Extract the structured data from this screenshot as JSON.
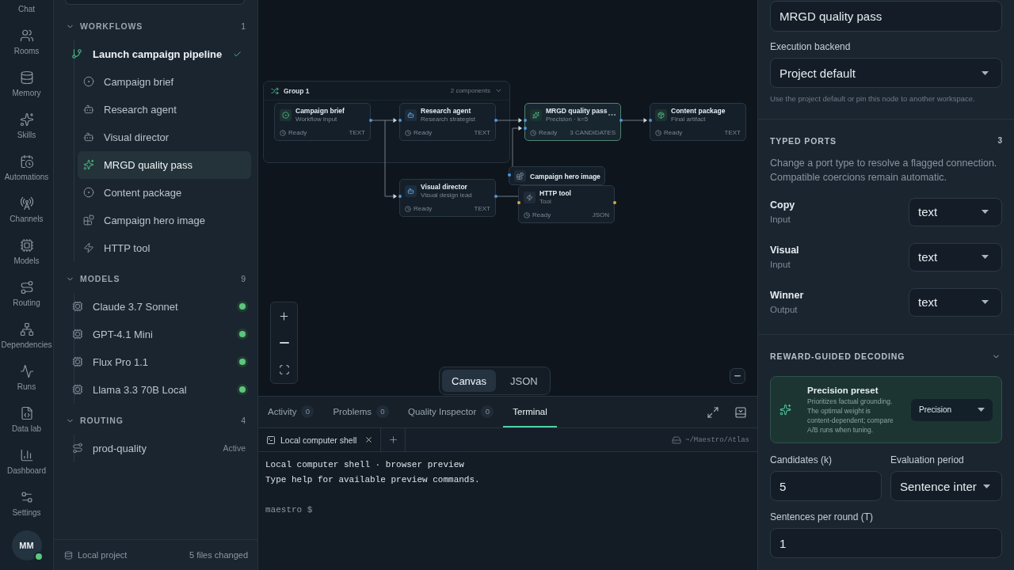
{
  "rail": {
    "partial_label": "Chat",
    "items": [
      {
        "label": "Rooms"
      },
      {
        "label": "Memory"
      },
      {
        "label": "Skills"
      },
      {
        "label": "Automations"
      },
      {
        "label": "Channels"
      },
      {
        "label": "Models"
      },
      {
        "label": "Routing"
      },
      {
        "label": "Dependencies"
      },
      {
        "label": "Runs"
      },
      {
        "label": "Data lab"
      },
      {
        "label": "Dashboard"
      },
      {
        "label": "Settings"
      }
    ],
    "avatar": {
      "initials": "MM",
      "online": true
    }
  },
  "sidebar": {
    "sections": [
      {
        "kind": "tree",
        "title": "WORKFLOWS",
        "count": "1",
        "expanded": true,
        "items": [
          {
            "label": "Launch campaign pipeline",
            "verified": true,
            "selected": false,
            "children": [
              {
                "label": "Campaign brief",
                "kind": "input",
                "selected": false
              },
              {
                "label": "Research agent",
                "kind": "agent",
                "selected": false
              },
              {
                "label": "Visual director",
                "kind": "agent",
                "selected": false
              },
              {
                "label": "MRGD quality pass",
                "kind": "evaluator",
                "selected": true
              },
              {
                "label": "Content package",
                "kind": "output",
                "selected": false
              },
              {
                "label": "Campaign hero image",
                "kind": "image",
                "selected": false
              },
              {
                "label": "HTTP tool",
                "kind": "tool",
                "selected": false
              }
            ]
          }
        ]
      },
      {
        "kind": "models",
        "title": "MODELS",
        "count": "9",
        "expanded": true,
        "items": [
          {
            "label": "Claude 3.7 Sonnet",
            "online": true
          },
          {
            "label": "GPT-4.1 Mini",
            "online": true
          },
          {
            "label": "Flux Pro 1.1",
            "online": true
          },
          {
            "label": "Llama 3.3 70B Local",
            "online": true
          }
        ]
      },
      {
        "kind": "routes",
        "title": "ROUTING",
        "count": "4",
        "expanded": true,
        "items": [
          {
            "label": "prod-quality",
            "status": "Active"
          }
        ]
      }
    ],
    "footer": {
      "project": "Local project",
      "changes": "5 files changed"
    }
  },
  "canvas": {
    "group": {
      "title": "Group 1",
      "count": "2 components",
      "expanded": true
    },
    "nodes": [
      {
        "title": "Campaign brief",
        "subtitle": "Workflow input",
        "status": "Ready",
        "port_type": "TEXT",
        "kind": "input",
        "selected": false
      },
      {
        "title": "Research agent",
        "subtitle": "Research strategist",
        "status": "Ready",
        "port_type": "TEXT",
        "kind": "agent",
        "selected": false
      },
      {
        "title": "MRGD quality pass",
        "subtitle": "Precision · k=5",
        "status": "Ready",
        "port_type": "3 CANDIDATES",
        "kind": "evaluator",
        "selected": true
      },
      {
        "title": "Content package",
        "subtitle": "Final artifact",
        "status": "Ready",
        "port_type": "TEXT",
        "kind": "output",
        "selected": false
      },
      {
        "title": "Visual director",
        "subtitle": "Visual design lead",
        "status": "Ready",
        "port_type": "TEXT",
        "kind": "agent",
        "selected": false
      },
      {
        "title": "Campaign hero image",
        "kind": "image",
        "selected": false
      },
      {
        "title": "HTTP tool",
        "subtitle": "Tool",
        "status": "Ready",
        "port_type": "JSON",
        "kind": "tool",
        "selected": false
      }
    ],
    "view_toggle": [
      {
        "label": "Canvas",
        "selected": true
      },
      {
        "label": "JSON",
        "selected": false
      }
    ]
  },
  "bottom_panel": {
    "tabs": [
      {
        "label": "Activity",
        "count": "0",
        "selected": false
      },
      {
        "label": "Problems",
        "count": "0",
        "selected": false
      },
      {
        "label": "Quality Inspector",
        "count": "0",
        "selected": false
      },
      {
        "label": "Terminal",
        "selected": true
      }
    ],
    "terminal": {
      "sessions": [
        {
          "label": "Local computer shell",
          "selected": true
        }
      ],
      "cwd": "~/Maestro/Atlas",
      "lines": [
        "Local computer shell · browser preview",
        "Type help for available preview commands."
      ],
      "prompt": "maestro $"
    }
  },
  "inspector": {
    "name_field": {
      "value": "MRGD quality pass"
    },
    "execution_backend": {
      "label": "Execution backend",
      "value": "Project default",
      "help": "Use the project default or pin this node to another workspace."
    },
    "typed_ports": {
      "title": "TYPED PORTS",
      "count": "3",
      "description": "Change a port type to resolve a flagged connection. Compatible coercions remain automatic.",
      "ports": [
        {
          "name": "Copy",
          "direction": "Input",
          "type": "text"
        },
        {
          "name": "Visual",
          "direction": "Input",
          "type": "text"
        },
        {
          "name": "Winner",
          "direction": "Output",
          "type": "text"
        }
      ]
    },
    "reward_guided_decoding": {
      "title": "REWARD-GUIDED DECODING",
      "expanded": true,
      "preset": {
        "title": "Precision preset",
        "description": "Prioritizes factual grounding. The optimal weight is content-dependent; compare A/B runs when tuning.",
        "value": "Precision"
      },
      "fields": [
        {
          "label": "Candidates (k)",
          "value": "5",
          "kind": "input"
        },
        {
          "label": "Evaluation period",
          "value": "Sentence inter",
          "kind": "select"
        },
        {
          "label": "Sentences per round (T)",
          "value": "1",
          "kind": "input"
        }
      ]
    }
  }
}
